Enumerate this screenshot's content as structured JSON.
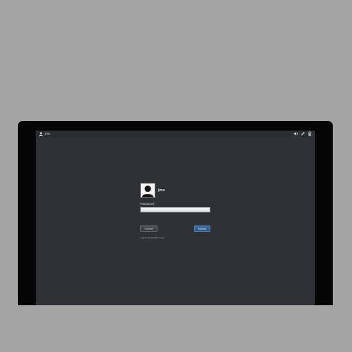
{
  "topbar": {
    "username": "jmu",
    "user_icon": "user-icon",
    "status_icons": [
      "volume-icon",
      "pen-icon",
      "battery-icon"
    ]
  },
  "login": {
    "username": "jmu",
    "avatar_icon": "user-silhouette-icon",
    "password_label": "Password:",
    "password_value": "",
    "cancel_label": "Cancel",
    "unlock_label": "Unlock",
    "other_user_link": "Log in as another user"
  },
  "colors": {
    "background": "#a4a4a4",
    "monitor_bezel": "#050505",
    "screen": "#2e3236",
    "accent": "#2c5487"
  }
}
